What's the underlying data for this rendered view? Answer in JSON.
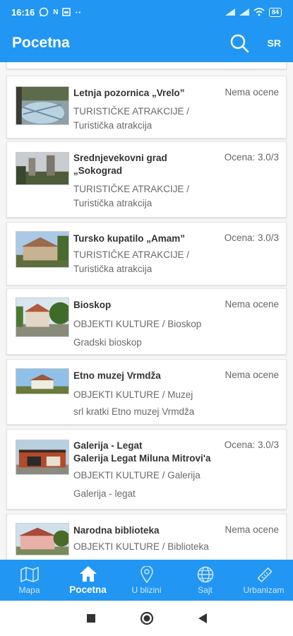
{
  "status_bar": {
    "time": "16:16",
    "icons": [
      "whatsapp-icon",
      "nfc-icon",
      "sim-icon",
      "more-dots"
    ],
    "battery": "84"
  },
  "app_bar": {
    "title": "Pocetna",
    "lang": "SR"
  },
  "items": [
    {
      "title": "Letnja pozornica „Vrelo”",
      "rating": "Nema ocene",
      "lines": [
        "TURISTIČKE ATRAKCIJE /",
        "Turistička atrakcija"
      ]
    },
    {
      "title": "Srednjevekovni grad „Sokograd",
      "rating": "Ocena: 3.0/3",
      "lines": [
        "TURISTIČKE ATRAKCIJE /",
        "Turistička atrakcija"
      ]
    },
    {
      "title": "Tursko kupatilo „Amam”",
      "rating": "Ocena: 3.0/3",
      "lines": [
        "TURISTIČKE ATRAKCIJE /",
        "Turistička atrakcija"
      ]
    },
    {
      "title": "Bioskop",
      "rating": "Nema ocene",
      "lines": [
        "OBJEKTI KULTURE / Bioskop",
        "Gradski bioskop"
      ]
    },
    {
      "title": "Etno muzej Vrmdža",
      "rating": "Nema ocene",
      "lines": [
        "OBJEKTI KULTURE / Muzej",
        "srl kratki Etno muzej Vrmdža"
      ]
    },
    {
      "title": "Galerija - Legat",
      "subtitle": "Galerija Legat Miluna Mitrovi'a",
      "rating": "Ocena: 3.0/3",
      "lines": [
        "OBJEKTI KULTURE / Galerija",
        "Galerija - legat"
      ]
    },
    {
      "title": "Narodna biblioteka",
      "rating": "Nema ocene",
      "lines": [
        "OBJEKTI KULTURE / Biblioteka"
      ]
    }
  ],
  "bottom_nav": [
    {
      "label": "Mapa",
      "icon": "map-icon"
    },
    {
      "label": "Pocetna",
      "icon": "home-icon",
      "active": true
    },
    {
      "label": "U blizini",
      "icon": "location-pin-icon"
    },
    {
      "label": "Sajt",
      "icon": "globe-icon"
    },
    {
      "label": "Urbanizam",
      "icon": "ruler-icon"
    }
  ],
  "colors": {
    "primary": "#2196f3",
    "inactive_nav": "#cfe6fb"
  }
}
